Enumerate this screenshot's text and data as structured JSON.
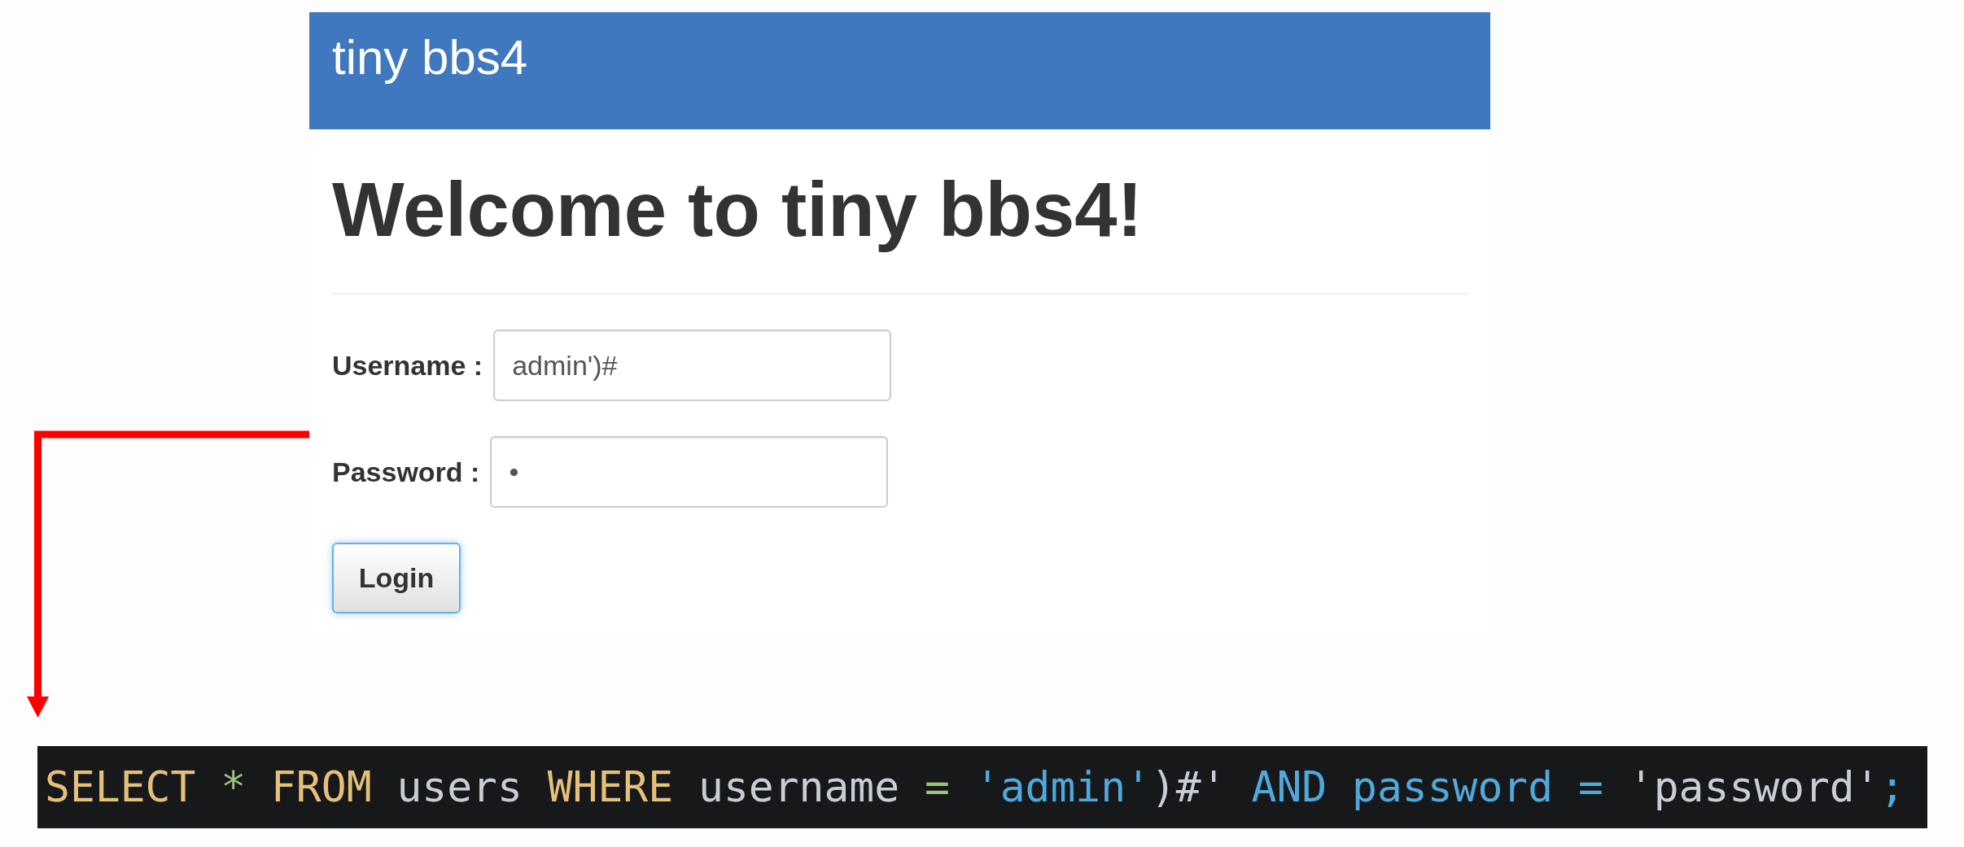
{
  "header": {
    "title": "tiny bbs4"
  },
  "heading": "Welcome to tiny bbs4!",
  "form": {
    "fields": [
      {
        "label": "Username :",
        "value": "admin')#"
      },
      {
        "label": "Password :",
        "value": "•"
      }
    ],
    "button": {
      "label": "Login",
      "focused": true
    }
  },
  "query": {
    "tokens": [
      {
        "text": "SELECT",
        "color": "#e5c07b"
      },
      {
        "text": " *",
        "color": "#98c379"
      },
      {
        "text": " FROM",
        "color": "#e5c07b"
      },
      {
        "text": " users",
        "color": "#c8cdd6"
      },
      {
        "text": " WHERE",
        "color": "#e5c07b"
      },
      {
        "text": " username",
        "color": "#c8cdd6"
      },
      {
        "text": " =",
        "color": "#98c379"
      },
      {
        "text": " 'admin'",
        "color": "#4fa9dc"
      },
      {
        "text": ")#'",
        "color": "#c8cdd6"
      },
      {
        "text": " AND password =",
        "color": "#4fa9dc"
      },
      {
        "text": " 'password'",
        "color": "#c8cdd6"
      },
      {
        "text": ";",
        "color": "#4fa9dc"
      }
    ]
  }
}
